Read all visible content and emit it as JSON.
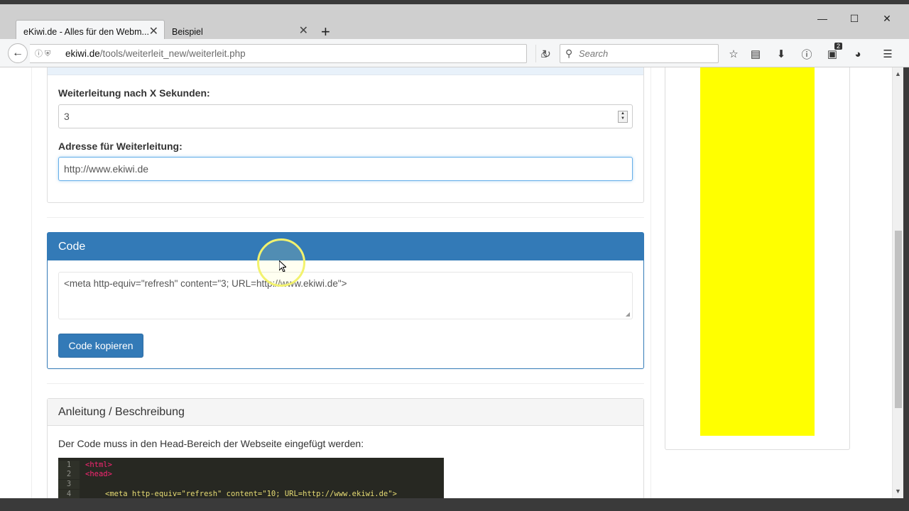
{
  "browser": {
    "tabs": [
      {
        "label": "eKiwi.de - Alles für den Webm...",
        "active": true
      },
      {
        "label": "Beispiel",
        "active": false
      }
    ],
    "url_domain": "ekiwi.de",
    "url_path": "/tools/weiterleit_new/weiterleit.php",
    "search_placeholder": "Search",
    "notification_count": "2"
  },
  "form": {
    "seconds_label": "Weiterleitung nach X Sekunden:",
    "seconds_value": "3",
    "address_label": "Adresse für Weiterleitung:",
    "address_value": "http://www.ekiwi.de"
  },
  "code_panel": {
    "title": "Code",
    "code": "<meta http-equiv=\"refresh\" content=\"3; URL=http://www.ekiwi.de\">",
    "copy_button": "Code kopieren"
  },
  "instructions": {
    "title": "Anleitung / Beschreibung",
    "text": "Der Code muss in den Head-Bereich der Webseite eingefügt werden:",
    "lines": [
      {
        "num": "1",
        "code": "<html>"
      },
      {
        "num": "2",
        "code": "<head>"
      },
      {
        "num": "3",
        "code": ""
      },
      {
        "num": "4",
        "code": "<meta http-equiv=\"refresh\" content=\"10; URL=http://www.ekiwi.de\">"
      }
    ]
  },
  "colors": {
    "primary": "#337ab7",
    "ad_yellow": "#ffff00",
    "code_bg": "#272822"
  },
  "icons": [
    "back-icon",
    "info-icon",
    "shield-icon",
    "reload-icon",
    "home-icon",
    "search-icon",
    "star-icon",
    "reader-icon",
    "download-icon",
    "info-icon",
    "notification-icon",
    "extension-icon",
    "menu-icon"
  ]
}
